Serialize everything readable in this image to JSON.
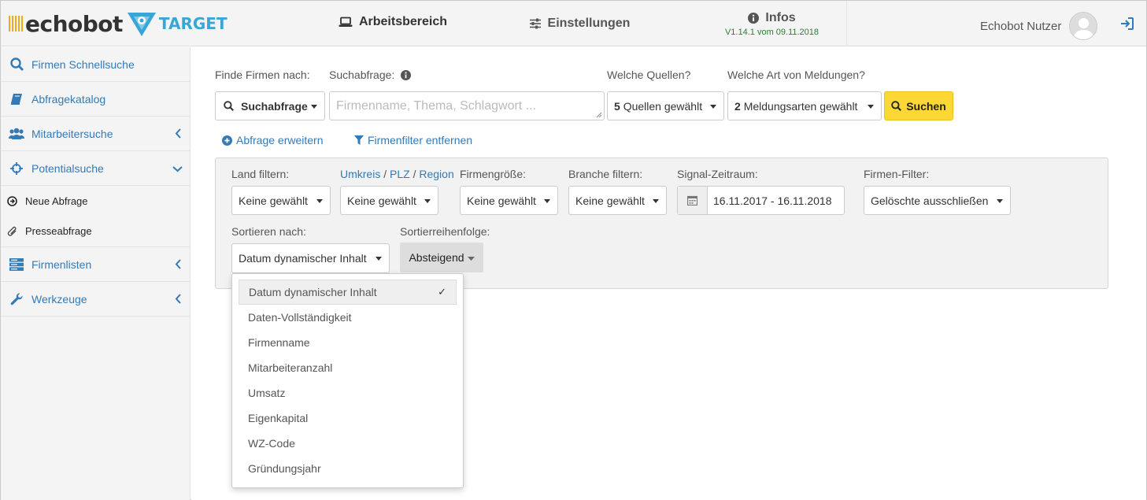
{
  "brand": {
    "name": "echobot",
    "product": "TARGET"
  },
  "nav": {
    "workspace": "Arbeitsbereich",
    "settings": "Einstellungen",
    "infos": "Infos",
    "version": "V1.14.1 vom 09.11.2018"
  },
  "user": {
    "name": "Echobot Nutzer"
  },
  "sidebar": {
    "items": [
      {
        "label": "Firmen Schnellsuche",
        "icon": "search-icon"
      },
      {
        "label": "Abfragekatalog",
        "icon": "book-icon"
      },
      {
        "label": "Mitarbeitersuche",
        "icon": "users-icon"
      },
      {
        "label": "Potentialsuche",
        "icon": "crosshairs-icon"
      }
    ],
    "subitems": [
      {
        "label": "Neue Abfrage",
        "icon": "arrow-circle-icon"
      },
      {
        "label": "Presseabfrage",
        "icon": "paperclip-icon"
      }
    ],
    "bottom": [
      {
        "label": "Firmenlisten",
        "icon": "server-icon"
      },
      {
        "label": "Werkzeuge",
        "icon": "wrench-icon"
      }
    ]
  },
  "search": {
    "find_label": "Finde Firmen nach:",
    "query_label": "Suchabfrage:",
    "sources_label": "Welche Quellen?",
    "types_label": "Welche Art von Meldungen?",
    "mode_value": "Suchabfrage",
    "query_placeholder": "Firmenname, Thema, Schlagwort ...",
    "sources_count": "5",
    "sources_value": "Quellen gewählt",
    "types_count": "2",
    "types_value": "Meldungsarten gewählt",
    "search_button": "Suchen",
    "extend_link": "Abfrage erweitern",
    "remove_filter_link": "Firmenfilter entfernen"
  },
  "filters": {
    "country_label": "Land filtern:",
    "radius_label": "Umkreis",
    "slash1": "/",
    "plz_label": "PLZ",
    "slash2": "/",
    "region_label": "Region",
    "size_label": "Firmengröße:",
    "branch_label": "Branche filtern:",
    "period_label": "Signal-Zeitraum:",
    "company_filter_label": "Firmen-Filter:",
    "country_value": "Keine gewählt",
    "radius_value": "Keine gewählt",
    "size_value": "Keine gewählt",
    "branch_value": "Keine gewählt",
    "period_value": "16.11.2017 - 16.11.2018",
    "company_filter_value": "Gelöschte ausschließen",
    "sort_label": "Sortieren nach:",
    "sort_order_label": "Sortierreihenfolge:",
    "sort_value": "Datum dynamischer Inhalt",
    "sort_order_value": "Absteigend"
  },
  "sort_options": [
    "Datum dynamischer Inhalt",
    "Daten-Vollständigkeit",
    "Firmenname",
    "Mitarbeiteranzahl",
    "Umsatz",
    "Eigenkapital",
    "WZ-Code",
    "Gründungsjahr"
  ],
  "colors": {
    "accent": "#337ab7",
    "search_button": "#fdd835",
    "logo_orange": "#f0a81c",
    "logo_blue": "#3aa6d8",
    "version_green": "#2e7d32"
  }
}
